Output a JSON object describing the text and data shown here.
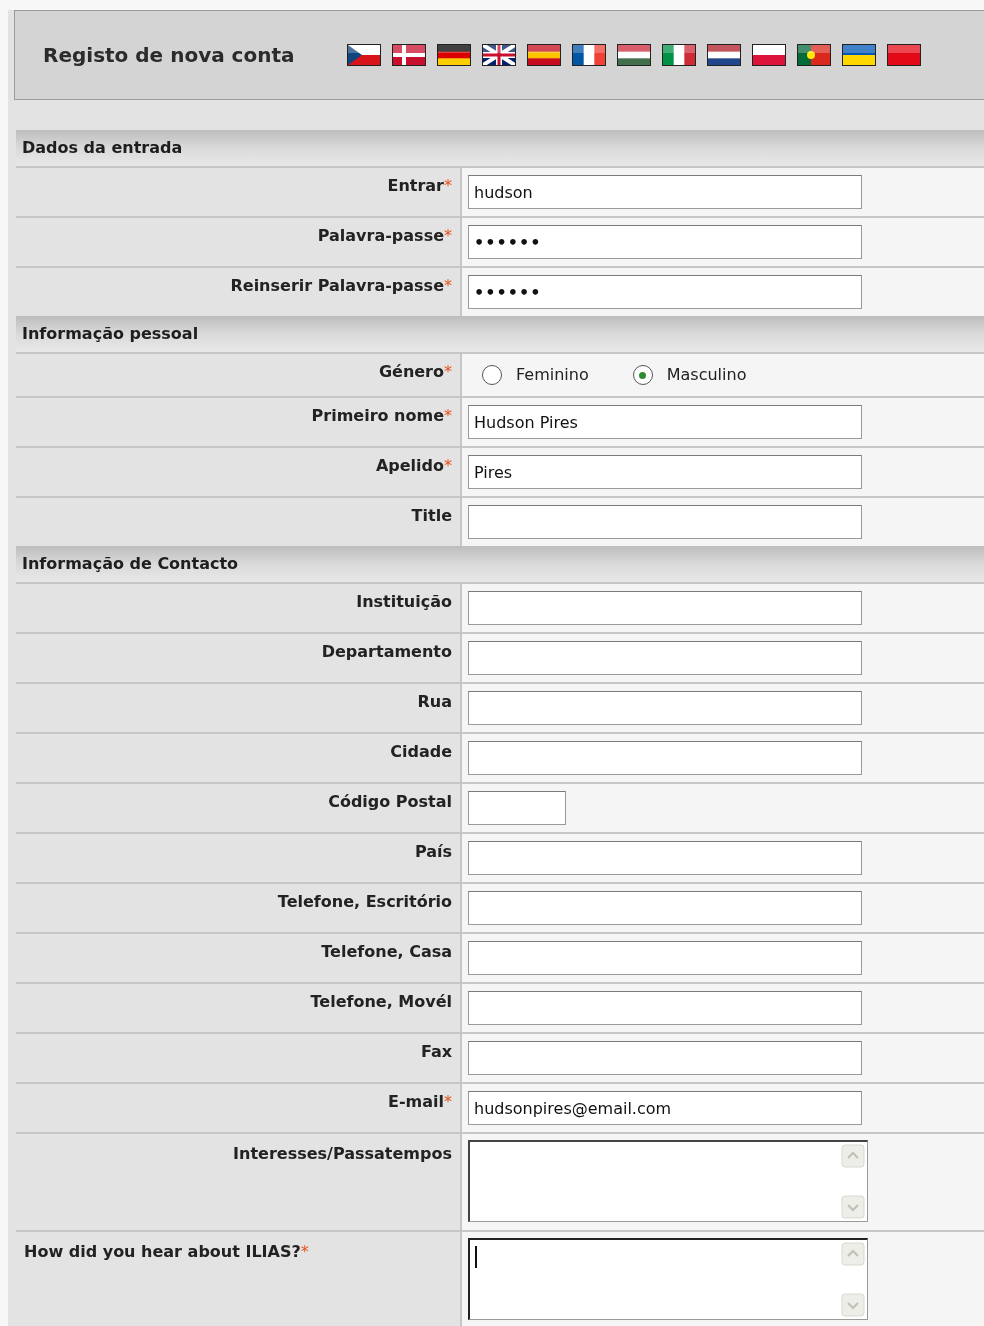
{
  "header": {
    "title": "Registo de nova conta"
  },
  "sections": [
    {
      "title": "Dados da entrada",
      "fields": [
        {
          "label": "Entrar",
          "required_mark": "*",
          "kind": "text",
          "value": "hudson"
        },
        {
          "label": "Palavra-passe",
          "required_mark": "*",
          "kind": "password",
          "value": "••••••"
        },
        {
          "label": "Reinserir Palavra-passe",
          "required_mark": "*",
          "kind": "password",
          "value": "••••••"
        }
      ]
    },
    {
      "title": "Informação pessoal",
      "fields": [
        {
          "label": "Género",
          "required_mark": "*",
          "kind": "radio",
          "options": [
            {
              "label": "Feminino",
              "selected": false
            },
            {
              "label": "Masculino",
              "selected": true
            }
          ]
        },
        {
          "label": "Primeiro nome",
          "required_mark": "*",
          "kind": "text",
          "value": "Hudson Pires"
        },
        {
          "label": "Apelido",
          "required_mark": "*",
          "kind": "text",
          "value": "Pires"
        },
        {
          "label": "Title",
          "kind": "text"
        }
      ]
    },
    {
      "title": "Informação de Contacto",
      "fields": [
        {
          "label": "Instituição",
          "kind": "text"
        },
        {
          "label": "Departamento",
          "kind": "text"
        },
        {
          "label": "Rua",
          "kind": "text"
        },
        {
          "label": "Cidade",
          "kind": "text"
        },
        {
          "label": "Código Postal",
          "kind": "short"
        },
        {
          "label": "País",
          "kind": "text"
        },
        {
          "label": "Telefone, Escritório",
          "kind": "text"
        },
        {
          "label": "Telefone, Casa",
          "kind": "text"
        },
        {
          "label": "Telefone, Movél",
          "kind": "text"
        },
        {
          "label": "Fax",
          "kind": "text"
        },
        {
          "label": "E-mail",
          "required_mark": "*",
          "kind": "text",
          "value": "hudsonpires@email.com"
        },
        {
          "label": "Interesses/Passatempos",
          "kind": "textarea",
          "focused": false
        },
        {
          "label": "How did you hear about ILIAS?",
          "required_mark": "*",
          "kind": "textarea",
          "focused": true
        }
      ]
    }
  ]
}
